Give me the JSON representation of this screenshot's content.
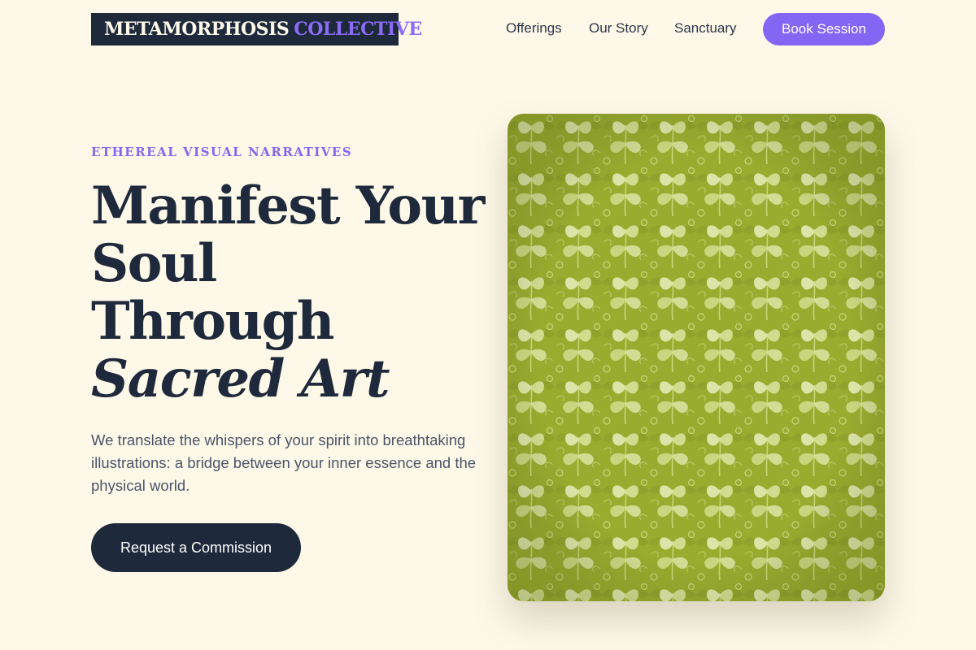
{
  "header": {
    "logo": {
      "word1": "METAMORPHOSIS",
      "word2": "COLLECTIVE"
    },
    "nav": [
      {
        "label": "Offerings"
      },
      {
        "label": "Our Story"
      },
      {
        "label": "Sanctuary"
      }
    ],
    "cta_label": "Book Session"
  },
  "hero": {
    "eyebrow": "ETHEREAL VISUAL NARRATIVES",
    "headline": {
      "line1": "Manifest Your",
      "line2": "Soul",
      "line3": "Through",
      "line4_italic": "Sacred Art"
    },
    "lede": "We translate the whispers of your spirit into breathtaking illustrations: a bridge between your inner essence and the physical world.",
    "cta_label": "Request a Commission"
  },
  "artwork": {
    "subject": "green-leaf-damask-pattern",
    "colors": {
      "base": "#9aab2f",
      "leaf": "#e4ecb4",
      "shade": "#7e9224"
    }
  },
  "colors": {
    "background": "#fdf8e8",
    "ink": "#1e293b",
    "accent": "#8466f5",
    "muted": "#4a5568"
  }
}
